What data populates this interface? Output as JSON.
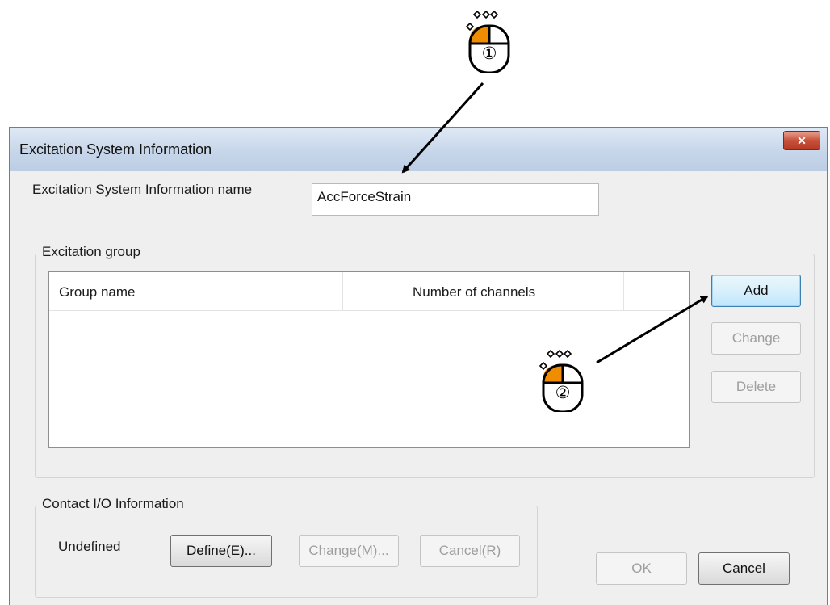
{
  "dialog": {
    "title": "Excitation System Information",
    "close_icon": "close-x-icon",
    "name_label": "Excitation System Information name",
    "name_value": "AccForceStrain",
    "excitation_group": {
      "caption": "Excitation group",
      "columns": [
        "Group name",
        "Number of channels",
        ""
      ],
      "rows": [],
      "buttons": {
        "add": "Add",
        "change": "Change",
        "delete": "Delete"
      }
    },
    "contact_io": {
      "caption": "Contact I/O Information",
      "status": "Undefined",
      "define": "Define(E)...",
      "change": "Change(M)...",
      "cancel": "Cancel(R)"
    },
    "ok": "OK",
    "cancel": "Cancel"
  },
  "annotations": {
    "step1": "①",
    "step2": "②",
    "mouse_icon": "mouse-left-click-icon",
    "accent_color": "#f08c00"
  }
}
